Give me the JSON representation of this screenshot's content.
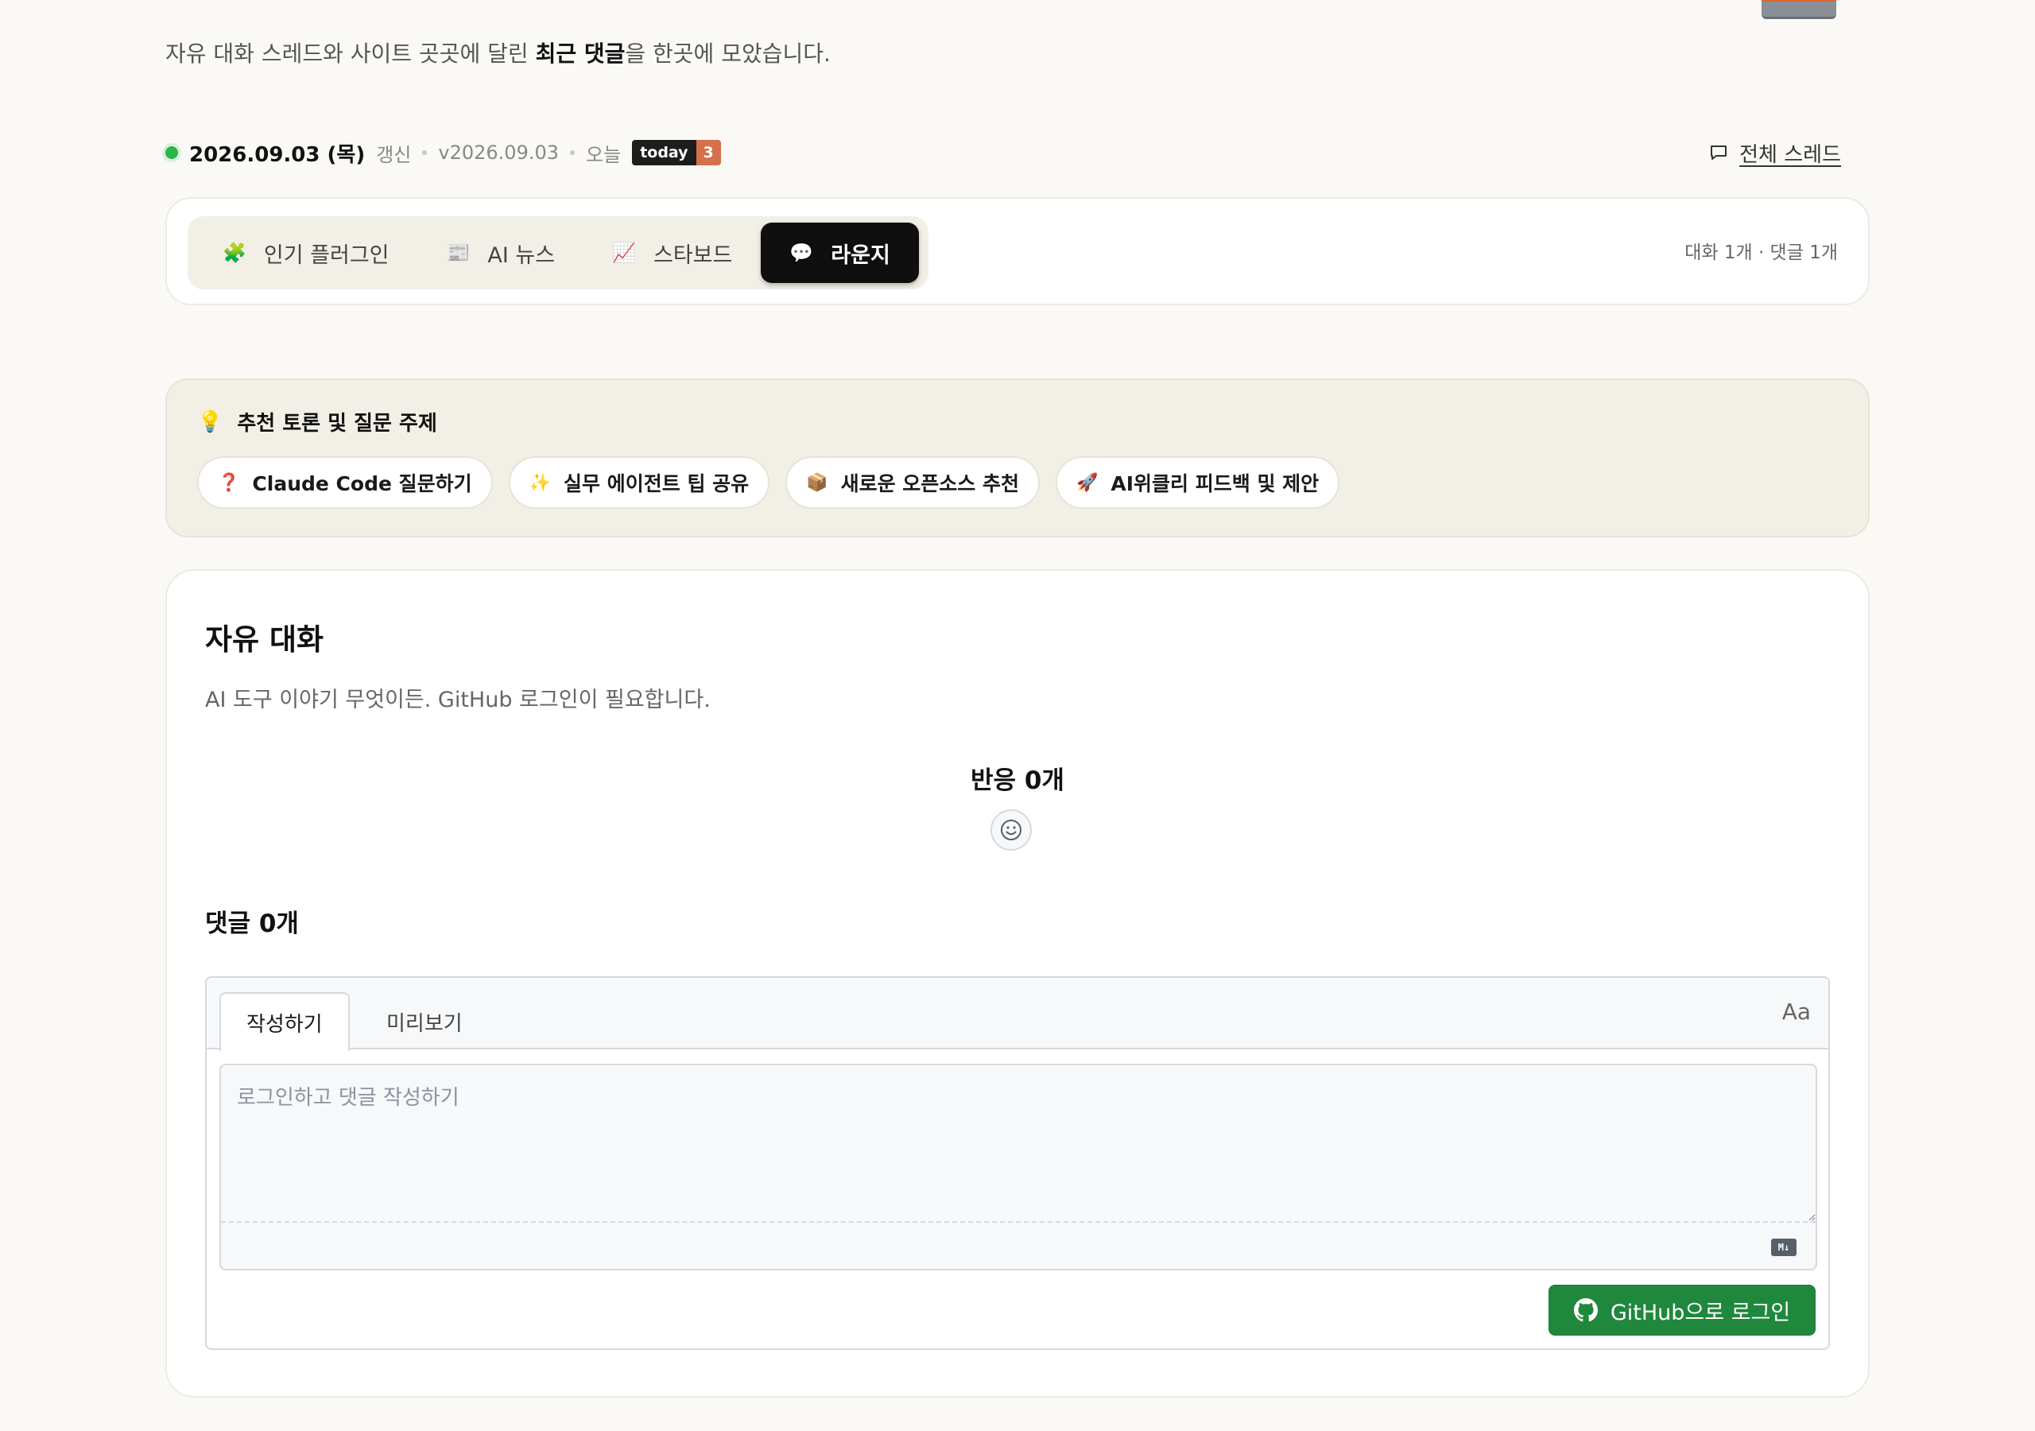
{
  "intro": {
    "prefix": "자유 대화 스레드와 사이트 곳곳에 달린 ",
    "bold": "최근 댓글",
    "suffix": "을 한곳에 모았습니다."
  },
  "status": {
    "date": "2026.09.03 (목)",
    "updated": "갱신",
    "version": "v2026.09.03",
    "today_prefix": "오늘",
    "today_badge": "today",
    "today_count": "3",
    "live_color": "#2fb34b"
  },
  "all_threads": {
    "label": "전체 스레드",
    "icon": "comment-icon"
  },
  "tabs": [
    {
      "label": "인기 플러그인",
      "icon": "🧩",
      "active": false
    },
    {
      "label": "AI 뉴스",
      "icon": "📰",
      "active": false
    },
    {
      "label": "스타보드",
      "icon": "📈",
      "active": false
    },
    {
      "label": "라운지",
      "icon": "💬",
      "active": true
    }
  ],
  "tab_stats": "대화 1개 · 댓글 1개",
  "topics": {
    "icon": "💡",
    "title": "추천 토론 및 질문 주제",
    "chips": [
      {
        "icon": "❓",
        "label": "Claude Code 질문하기"
      },
      {
        "icon": "✨",
        "label": "실무 에이전트 팁 공유"
      },
      {
        "icon": "📦",
        "label": "새로운 오픈소스 추천"
      },
      {
        "icon": "🚀",
        "label": "AI위클리 피드백 및 제안"
      }
    ]
  },
  "discussion": {
    "title": "자유 대화",
    "description": "AI 도구 이야기 무엇이든. GitHub 로그인이 필요합니다.",
    "reactions_label": "반응 0개",
    "comments_label": "댓글 0개"
  },
  "editor": {
    "write_tab": "작성하기",
    "preview_tab": "미리보기",
    "format_toggle": "Aa",
    "placeholder": "로그인하고 댓글 작성하기",
    "markdown_badge": "M↓",
    "login_button": "GitHub으로 로그인",
    "login_color": "#1f883d"
  }
}
